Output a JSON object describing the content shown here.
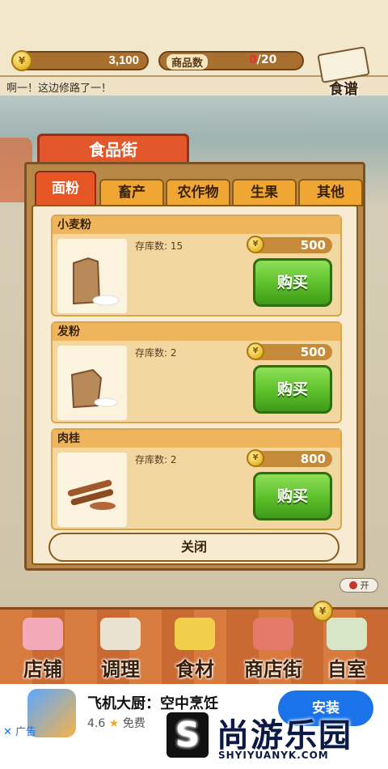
{
  "hud": {
    "coins": "3,100",
    "goods_label": "商品数",
    "goods_current": "0",
    "goods_max": "/20",
    "recipe_label": "食谱"
  },
  "ticker": "啊一！这边修路了一！",
  "market": {
    "title": "食品街",
    "tabs": [
      {
        "label": "面粉",
        "active": true
      },
      {
        "label": "畜产",
        "active": false
      },
      {
        "label": "农作物",
        "active": false
      },
      {
        "label": "生果",
        "active": false
      },
      {
        "label": "其他",
        "active": false
      }
    ],
    "items": [
      {
        "name": "小麦粉",
        "stock": "存库数: 15",
        "price": "500",
        "buy_label": "购买",
        "icon": "flour-bag-icon"
      },
      {
        "name": "发粉",
        "stock": "存库数: 2",
        "price": "500",
        "buy_label": "购买",
        "icon": "yeast-bag-icon"
      },
      {
        "name": "肉桂",
        "stock": "存库数: 2",
        "price": "800",
        "buy_label": "购买",
        "icon": "cinnamon-icon"
      }
    ],
    "close_label": "关闭"
  },
  "toggle_label": "开",
  "nav": [
    {
      "label": "店铺",
      "icon": "cake-icon"
    },
    {
      "label": "调理",
      "icon": "mixing-bowl-icon"
    },
    {
      "label": "食材",
      "icon": "ingredients-sack-icon"
    },
    {
      "label": "商店街",
      "icon": "storefront-icon"
    },
    {
      "label": "自室",
      "icon": "staff-door-icon"
    }
  ],
  "ad": {
    "app_name": "飞机大厨：空中烹饪",
    "rating": "4.6",
    "price": "免费",
    "install_label": "安装",
    "ad_label": "✕ 广告"
  },
  "watermark": {
    "logo_letter": "S",
    "text": "尚游乐园",
    "url": "SHYIYUANYK.COM"
  },
  "colors": {
    "tab_active": "#e65624",
    "tab_inactive": "#f0a633",
    "buy_green": "#5cbf2a",
    "install_blue": "#1a73e8"
  }
}
